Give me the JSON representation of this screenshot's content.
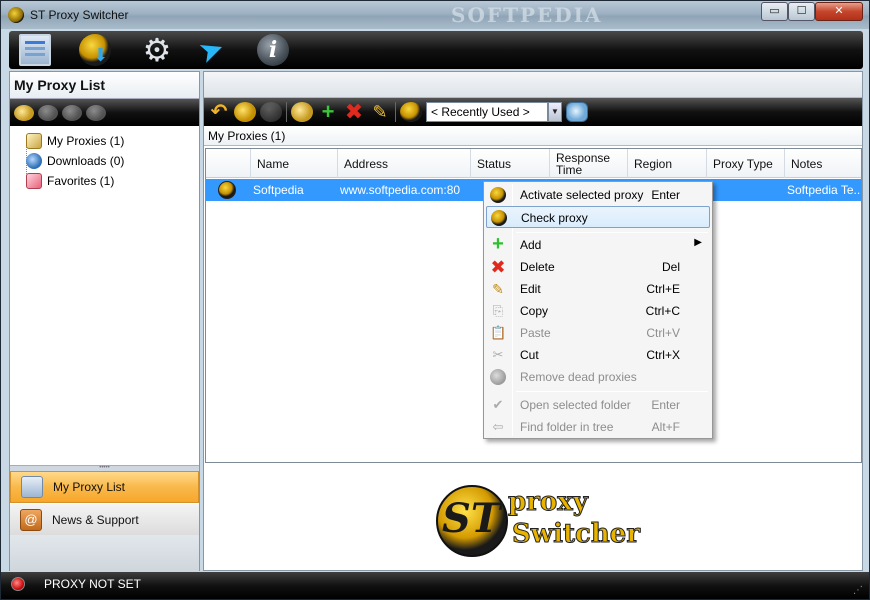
{
  "window": {
    "title": "ST Proxy Switcher",
    "watermark": "SOFTPEDIA",
    "min_label": "▭",
    "max_label": "☐",
    "close_label": "✕"
  },
  "main_toolbar": {
    "icons": [
      "proxy-list-icon",
      "update-globe-icon",
      "settings-gear-icon",
      "cursor-icon",
      "info-icon"
    ]
  },
  "left_panel": {
    "title": "My Proxy List",
    "tree": [
      {
        "label": "My Proxies (1)",
        "icon": "folder-icon"
      },
      {
        "label": "Downloads (0)",
        "icon": "download-icon"
      },
      {
        "label": "Favorites (1)",
        "icon": "favorites-icon"
      }
    ],
    "nav": [
      {
        "label": "My Proxy List",
        "active": true
      },
      {
        "label": "News & Support",
        "active": false
      }
    ]
  },
  "right_panel": {
    "recent_label": "< Recently Used >",
    "folder_label": "My Proxies (1)",
    "columns": [
      "Name",
      "Address",
      "Status",
      "Response Time",
      "Region",
      "Proxy Type",
      "Notes"
    ],
    "rows": [
      {
        "name": "Softpedia",
        "address": "www.softpedia.com:80",
        "status": "",
        "response_time": "",
        "region": "",
        "proxy_type": "",
        "notes": "Softpedia Te..."
      }
    ],
    "logo_line1": "proxy",
    "logo_line2": "Switcher"
  },
  "context_menu": {
    "items": [
      {
        "label": "Activate selected proxy",
        "shortcut": "Enter",
        "icon": "globe-icon",
        "disabled": false
      },
      {
        "label": "Check proxy",
        "shortcut": "",
        "icon": "globe-icon",
        "disabled": false,
        "hover": true
      },
      {
        "label": "Add",
        "shortcut": "",
        "icon": "plus-icon",
        "disabled": false,
        "submenu": true
      },
      {
        "label": "Delete",
        "shortcut": "Del",
        "icon": "delete-icon",
        "disabled": false
      },
      {
        "label": "Edit",
        "shortcut": "Ctrl+E",
        "icon": "pencil-icon",
        "disabled": false
      },
      {
        "label": "Copy",
        "shortcut": "Ctrl+C",
        "icon": "copy-icon",
        "disabled": false
      },
      {
        "label": "Paste",
        "shortcut": "Ctrl+V",
        "icon": "paste-icon",
        "disabled": true
      },
      {
        "label": "Cut",
        "shortcut": "Ctrl+X",
        "icon": "cut-icon",
        "disabled": false
      },
      {
        "label": "Remove dead proxies",
        "shortcut": "",
        "icon": "remove-dead-icon",
        "disabled": true
      },
      {
        "label": "Open selected folder",
        "shortcut": "Enter",
        "icon": "open-folder-icon",
        "disabled": true
      },
      {
        "label": "Find folder in tree",
        "shortcut": "Alt+F",
        "icon": "find-folder-icon",
        "disabled": true
      }
    ]
  },
  "status": {
    "text": "PROXY NOT SET",
    "color": "#d01010"
  },
  "colors": {
    "selection": "#3399ff",
    "active_nav": "#f9b94b"
  }
}
